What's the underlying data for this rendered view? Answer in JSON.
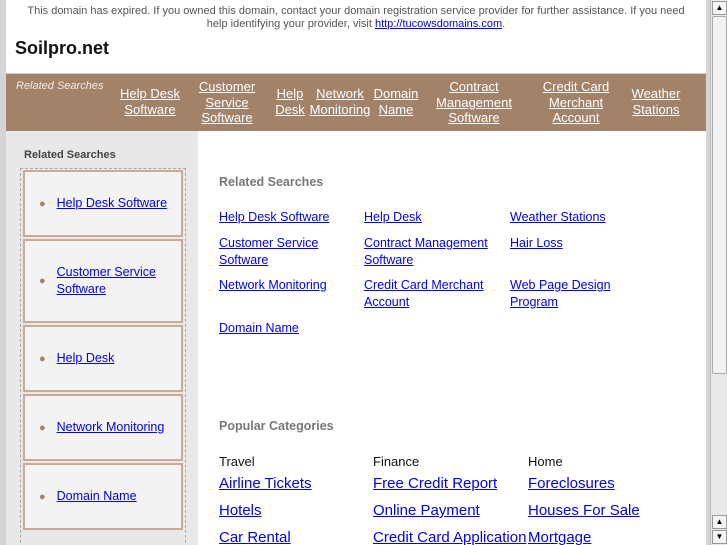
{
  "notice": {
    "text": "This domain has expired. If you owned this domain, contact your domain registration service provider for further assistance. If you need help identifying your provider, visit ",
    "link": "http://tucowsdomains.com",
    "tail": "."
  },
  "site_title": "Soilpro.net",
  "topnav": {
    "label": "Related Searches",
    "links": [
      "Help Desk Software",
      "Customer Service Software",
      "Help Desk",
      "Network Monitoring",
      "Domain Name",
      "Contract Management Software",
      "Credit Card Merchant Account",
      "Weather Stations"
    ]
  },
  "sidebar": {
    "heading": "Related Searches",
    "items": [
      "Help Desk Software",
      "Customer Service Software",
      "Help Desk",
      "Network Monitoring",
      "Domain Name"
    ]
  },
  "related": {
    "heading": "Related Searches",
    "links": [
      "Help Desk Software",
      "Help Desk",
      "Weather Stations",
      "Customer Service Software",
      "Contract Management Software",
      "Hair Loss",
      "Network Monitoring",
      "Credit Card Merchant Account",
      "Web Page Design Program",
      "Domain Name"
    ]
  },
  "popular": {
    "heading": "Popular Categories",
    "categories": [
      {
        "name": "Travel",
        "links": [
          "Airline Tickets",
          "Hotels",
          "Car Rental"
        ]
      },
      {
        "name": "Finance",
        "links": [
          "Free Credit Report",
          "Online Payment",
          "Credit Card Application"
        ]
      },
      {
        "name": "Home",
        "links": [
          "Foreclosures",
          "Houses For Sale",
          "Mortgage"
        ]
      }
    ]
  }
}
